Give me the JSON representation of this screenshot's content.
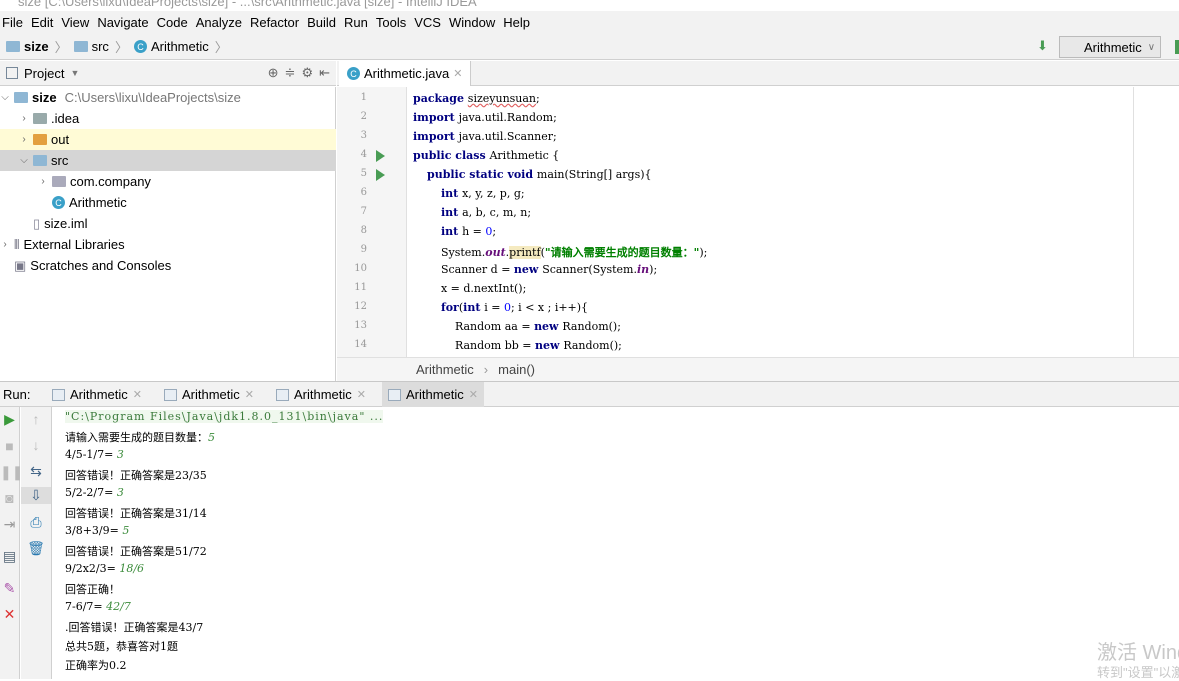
{
  "window": {
    "title": "size [C:\\Users\\lixu\\IdeaProjects\\size] - ...\\src\\Arithmetic.java [size] - IntelliJ IDEA"
  },
  "menu": [
    "File",
    "Edit",
    "View",
    "Navigate",
    "Code",
    "Analyze",
    "Refactor",
    "Build",
    "Run",
    "Tools",
    "VCS",
    "Window",
    "Help"
  ],
  "nav": {
    "crumbs": [
      "size",
      "src",
      "Arithmetic"
    ],
    "run_config": "Arithmetic"
  },
  "project": {
    "header": "Project",
    "tree": [
      {
        "label": "size",
        "path": "C:\\Users\\lixu\\IdeaProjects\\size",
        "indent": 0,
        "arrow": "v",
        "icon": "module-folder-icon",
        "bold": true
      },
      {
        "label": ".idea",
        "indent": 1,
        "arrow": ">",
        "icon": "folder-icon"
      },
      {
        "label": "out",
        "indent": 1,
        "arrow": ">",
        "icon": "orange-folder-icon",
        "state": "hl"
      },
      {
        "label": "src",
        "indent": 1,
        "arrow": "v",
        "icon": "source-folder-icon",
        "state": "sel"
      },
      {
        "label": "com.company",
        "indent": 2,
        "arrow": ">",
        "icon": "package-icon"
      },
      {
        "label": "Arithmetic",
        "indent": 2,
        "arrow": "",
        "icon": "class-icon"
      },
      {
        "label": "size.iml",
        "indent": 1,
        "arrow": "",
        "icon": "file-icon"
      },
      {
        "label": "External Libraries",
        "indent": 0,
        "arrow": ">",
        "icon": "library-icon"
      },
      {
        "label": "Scratches and Consoles",
        "indent": 0,
        "arrow": "",
        "icon": "scratches-icon"
      }
    ]
  },
  "editor": {
    "tab": "Arithmetic.java",
    "lines": [
      [
        [
          "kw",
          "package "
        ],
        [
          "sq",
          "sizeyunsuan"
        ],
        [
          "",
          "; "
        ]
      ],
      [
        [
          "kw",
          "import "
        ],
        [
          "",
          "java.util.Random;"
        ]
      ],
      [
        [
          "kw",
          "import "
        ],
        [
          "",
          "java.util.Scanner;"
        ]
      ],
      [
        [
          "kw",
          "public class "
        ],
        [
          "",
          "Arithmetic {"
        ]
      ],
      [
        [
          "",
          "    "
        ],
        [
          "kw",
          "public static void "
        ],
        [
          "",
          "main(String[] args){"
        ]
      ],
      [
        [
          "",
          "        "
        ],
        [
          "kw",
          "int "
        ],
        [
          "",
          "x, y, z, p, g;"
        ]
      ],
      [
        [
          "",
          "        "
        ],
        [
          "kw",
          "int "
        ],
        [
          "",
          "a, b, c, m, n;"
        ]
      ],
      [
        [
          "",
          "        "
        ],
        [
          "kw",
          "int "
        ],
        [
          "",
          "h = "
        ],
        [
          "num",
          "0"
        ],
        [
          "",
          ";"
        ]
      ],
      [
        [
          "",
          "        System."
        ],
        [
          "st",
          "out"
        ],
        [
          "",
          "."
        ],
        [
          "hlw",
          "printf"
        ],
        [
          "",
          "("
        ],
        [
          "str",
          "\"请输入需要生成的题目数量：\""
        ],
        [
          "",
          ");"
        ]
      ],
      [
        [
          "",
          "        Scanner d = "
        ],
        [
          "kw",
          "new "
        ],
        [
          "",
          "Scanner(System."
        ],
        [
          "st",
          "in"
        ],
        [
          "",
          ");"
        ]
      ],
      [
        [
          "",
          "        x = d.nextInt();"
        ]
      ],
      [
        [
          "",
          "        "
        ],
        [
          "kw",
          "for"
        ],
        [
          "",
          "("
        ],
        [
          "kw",
          "int "
        ],
        [
          "",
          "i = "
        ],
        [
          "num",
          "0"
        ],
        [
          "",
          "; i < x ; i++){"
        ]
      ],
      [
        [
          "",
          "            Random aa = "
        ],
        [
          "kw",
          "new "
        ],
        [
          "",
          "Random();"
        ]
      ],
      [
        [
          "",
          "            Random bb = "
        ],
        [
          "kw",
          "new "
        ],
        [
          "",
          "Random();"
        ]
      ]
    ],
    "run_gutter_lines": [
      4,
      5
    ],
    "breadcrumb": [
      "Arithmetic",
      "main()"
    ]
  },
  "run": {
    "label": "Run:",
    "tabs": [
      "Arithmetic",
      "Arithmetic",
      "Arithmetic",
      "Arithmetic"
    ],
    "active_tab": 3,
    "console": [
      [
        [
          "cmd",
          "\"C:\\Program Files\\Java\\jdk1.8.0_131\\bin\\java\" ..."
        ]
      ],
      [
        [
          "",
          "请输入需要生成的题目数量："
        ],
        [
          "inp",
          "5"
        ]
      ],
      [
        [
          "",
          "4/5-1/7= "
        ],
        [
          "inp",
          "3"
        ]
      ],
      [
        [
          "",
          "回答错误！正确答案是23/35"
        ]
      ],
      [
        [
          "",
          "5/2-2/7= "
        ],
        [
          "inp",
          "3"
        ]
      ],
      [
        [
          "",
          "回答错误！正确答案是31/14"
        ]
      ],
      [
        [
          "",
          "3/8+3/9= "
        ],
        [
          "inp",
          "5"
        ]
      ],
      [
        [
          "",
          "回答错误！正确答案是51/72"
        ]
      ],
      [
        [
          "",
          "9/2x2/3= "
        ],
        [
          "inp",
          "18/6"
        ]
      ],
      [
        [
          "",
          "回答正确！"
        ]
      ],
      [
        [
          "",
          "7-6/7= "
        ],
        [
          "inp",
          "42/7"
        ]
      ],
      [
        [
          "",
          ".回答错误！正确答案是43/7"
        ]
      ],
      [
        [
          "",
          "总共5题，恭喜答对1题"
        ]
      ],
      [
        [
          "",
          "正确率为0.2"
        ]
      ]
    ]
  },
  "watermark": {
    "line1": "激活 Windows",
    "line2": "转到\"设置\"以激活 Windows。"
  }
}
